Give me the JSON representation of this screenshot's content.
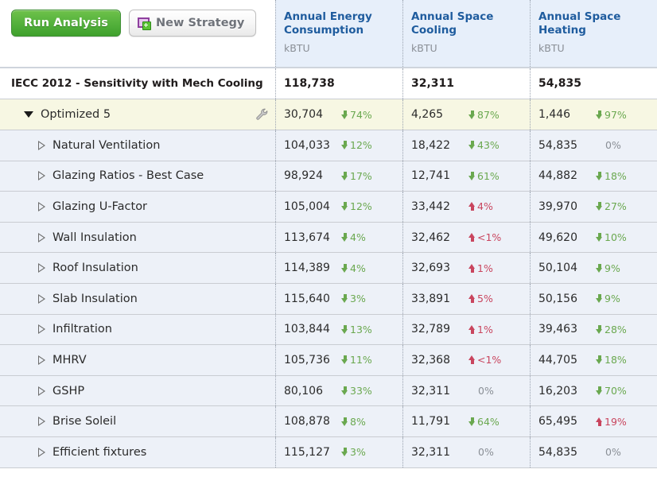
{
  "toolbar": {
    "run_analysis_label": "Run Analysis",
    "new_strategy_label": "New Strategy",
    "new_strategy_icon": "new-strategy-icon",
    "run_button_color": "#55b23d",
    "new_button_color": "#f2f2f2"
  },
  "columns": [
    {
      "title": "Annual Energy\nConsumption",
      "units": "kBTU"
    },
    {
      "title": "Annual Space\nCooling",
      "units": "kBTU"
    },
    {
      "title": "Annual Space\nHeating",
      "units": "kBTU"
    }
  ],
  "colors": {
    "header_text": "#1f5c9e",
    "header_bg": "#e7effa",
    "decrease": "#6aa84f",
    "increase": "#c9455e",
    "neutral": "#8a8f96",
    "strategy_row_bg": "#f7f7e3",
    "measure_row_bg": "#edf1f8"
  },
  "baseline": {
    "name": "IECC 2012 - Sensitivity with Mech Cooling",
    "cells": [
      {
        "value": "118,738",
        "delta": "",
        "direction": "none"
      },
      {
        "value": "32,311",
        "delta": "",
        "direction": "none"
      },
      {
        "value": "54,835",
        "delta": "",
        "direction": "none"
      }
    ]
  },
  "strategy": {
    "name": "Optimized 5",
    "expanded": true,
    "caret_icon": "caret-down-icon",
    "settings_icon": "wrench-icon",
    "cells": [
      {
        "value": "30,704",
        "delta": "74%",
        "direction": "down"
      },
      {
        "value": "4,265",
        "delta": "87%",
        "direction": "down"
      },
      {
        "value": "1,446",
        "delta": "97%",
        "direction": "down"
      }
    ]
  },
  "measures": [
    {
      "name": "Natural Ventilation",
      "caret_icon": "caret-right-icon",
      "cells": [
        {
          "value": "104,033",
          "delta": "12%",
          "direction": "down"
        },
        {
          "value": "18,422",
          "delta": "43%",
          "direction": "down"
        },
        {
          "value": "54,835",
          "delta": "0%",
          "direction": "flat"
        }
      ]
    },
    {
      "name": "Glazing Ratios - Best Case",
      "caret_icon": "caret-right-icon",
      "cells": [
        {
          "value": "98,924",
          "delta": "17%",
          "direction": "down"
        },
        {
          "value": "12,741",
          "delta": "61%",
          "direction": "down"
        },
        {
          "value": "44,882",
          "delta": "18%",
          "direction": "down"
        }
      ]
    },
    {
      "name": "Glazing U-Factor",
      "caret_icon": "caret-right-icon",
      "cells": [
        {
          "value": "105,004",
          "delta": "12%",
          "direction": "down"
        },
        {
          "value": "33,442",
          "delta": "4%",
          "direction": "up"
        },
        {
          "value": "39,970",
          "delta": "27%",
          "direction": "down"
        }
      ]
    },
    {
      "name": "Wall Insulation",
      "caret_icon": "caret-right-icon",
      "cells": [
        {
          "value": "113,674",
          "delta": "4%",
          "direction": "down"
        },
        {
          "value": "32,462",
          "delta": "<1%",
          "direction": "up"
        },
        {
          "value": "49,620",
          "delta": "10%",
          "direction": "down"
        }
      ]
    },
    {
      "name": "Roof Insulation",
      "caret_icon": "caret-right-icon",
      "cells": [
        {
          "value": "114,389",
          "delta": "4%",
          "direction": "down"
        },
        {
          "value": "32,693",
          "delta": "1%",
          "direction": "up"
        },
        {
          "value": "50,104",
          "delta": "9%",
          "direction": "down"
        }
      ]
    },
    {
      "name": "Slab Insulation",
      "caret_icon": "caret-right-icon",
      "cells": [
        {
          "value": "115,640",
          "delta": "3%",
          "direction": "down"
        },
        {
          "value": "33,891",
          "delta": "5%",
          "direction": "up"
        },
        {
          "value": "50,156",
          "delta": "9%",
          "direction": "down"
        }
      ]
    },
    {
      "name": "Infiltration",
      "caret_icon": "caret-right-icon",
      "cells": [
        {
          "value": "103,844",
          "delta": "13%",
          "direction": "down"
        },
        {
          "value": "32,789",
          "delta": "1%",
          "direction": "up"
        },
        {
          "value": "39,463",
          "delta": "28%",
          "direction": "down"
        }
      ]
    },
    {
      "name": "MHRV",
      "caret_icon": "caret-right-icon",
      "cells": [
        {
          "value": "105,736",
          "delta": "11%",
          "direction": "down"
        },
        {
          "value": "32,368",
          "delta": "<1%",
          "direction": "up"
        },
        {
          "value": "44,705",
          "delta": "18%",
          "direction": "down"
        }
      ]
    },
    {
      "name": "GSHP",
      "caret_icon": "caret-right-icon",
      "cells": [
        {
          "value": "80,106",
          "delta": "33%",
          "direction": "down"
        },
        {
          "value": "32,311",
          "delta": "0%",
          "direction": "flat"
        },
        {
          "value": "16,203",
          "delta": "70%",
          "direction": "down"
        }
      ]
    },
    {
      "name": "Brise Soleil",
      "caret_icon": "caret-right-icon",
      "cells": [
        {
          "value": "108,878",
          "delta": "8%",
          "direction": "down"
        },
        {
          "value": "11,791",
          "delta": "64%",
          "direction": "down"
        },
        {
          "value": "65,495",
          "delta": "19%",
          "direction": "up"
        }
      ]
    },
    {
      "name": "Efficient fixtures",
      "caret_icon": "caret-right-icon",
      "cells": [
        {
          "value": "115,127",
          "delta": "3%",
          "direction": "down"
        },
        {
          "value": "32,311",
          "delta": "0%",
          "direction": "flat"
        },
        {
          "value": "54,835",
          "delta": "0%",
          "direction": "flat"
        }
      ]
    }
  ]
}
